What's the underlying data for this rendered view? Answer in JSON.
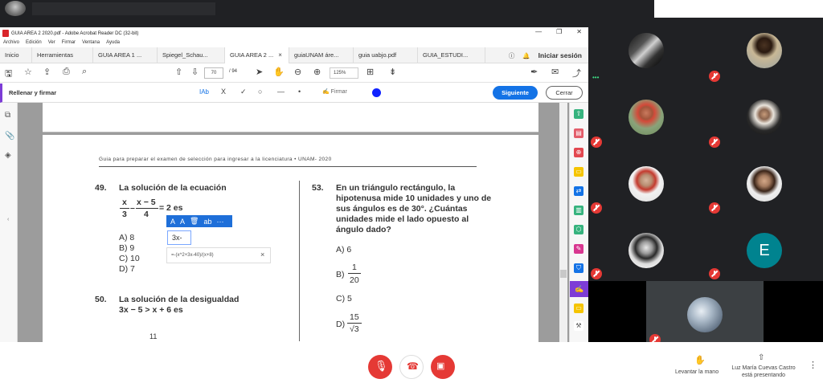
{
  "acrobat": {
    "window_title": "GUIA AREA 2 2020.pdf - Adobe Acrobat Reader DC (32-bit)",
    "menu": [
      "Archivo",
      "Edición",
      "Ver",
      "Firmar",
      "Ventana",
      "Ayuda"
    ],
    "tabs": [
      {
        "label": "Inicio"
      },
      {
        "label": "Herramientas"
      },
      {
        "label": "GUIA AREA 1 ..."
      },
      {
        "label": "Spiegel_Schau..."
      },
      {
        "label": "GUIA AREA 2 ..."
      },
      {
        "label": "guiaUNAM áre..."
      },
      {
        "label": "guia uabjo.pdf"
      },
      {
        "label": "GUIA_ESTUDI..."
      }
    ],
    "tab_close": "×",
    "signin": "Iniciar sesión",
    "page_current": "70",
    "page_total": "/ 94",
    "zoom": "125%",
    "fill_title": "Rellenar y firmar",
    "firmar": "Firmar",
    "siguiente": "Siguiente",
    "cerrar": "Cerrar",
    "fill_tools": [
      "IAb",
      "X",
      "✓",
      "○",
      "—",
      "•"
    ]
  },
  "document": {
    "header": "Guia para preparar el examen de selección para ingresar a la licenciatura • UNAM- 2020",
    "q49_num": "49.",
    "q49_text": "La solución de la ecuación",
    "q49_eq_a": "x",
    "q49_eq_b": "3",
    "q49_eq_c": "x − 5",
    "q49_eq_d": "4",
    "q49_eq_rest": "= 2  es",
    "q49_opts": [
      "A)  8",
      "B)  9",
      "C)  10",
      "D)  7"
    ],
    "q50_num": "50.",
    "q50_text": "La solución de la desigualdad",
    "q50_eq": "3x − 5 > x + 6 es",
    "page_number": "11",
    "q53_num": "53.",
    "q53_lines": [
      "En un triángulo rectángulo, la",
      "hipotenusa mide 10 unidades y uno de",
      "sus ángulos es de 30°. ¿Cuántas",
      "unidades mide el lado opuesto al",
      "ángulo dado?"
    ],
    "q53_a": "A)  6",
    "q53_b": "B)",
    "q53_b_num": "1",
    "q53_b_den": "20",
    "q53_c": "C)  5",
    "q53_d": "D)",
    "q53_d_num": "15",
    "q53_d_den": "√3"
  },
  "popup": {
    "toolbar": [
      "A",
      "A",
      "🗑",
      "ab",
      "···"
    ],
    "field_value": "3x-",
    "suggestion": "=-(x^2+3x-40)/(x+8)",
    "close": "×"
  },
  "meet": {
    "participant_e": "E",
    "raise_hand": "Levantar la mano",
    "presenter_line1": "Luz María Cuevas Castro",
    "presenter_line2": "está presentando",
    "colors": {
      "mute_red": "#e53935",
      "teal_avatar": "#00838f",
      "adobe_blue": "#1473e6"
    }
  }
}
